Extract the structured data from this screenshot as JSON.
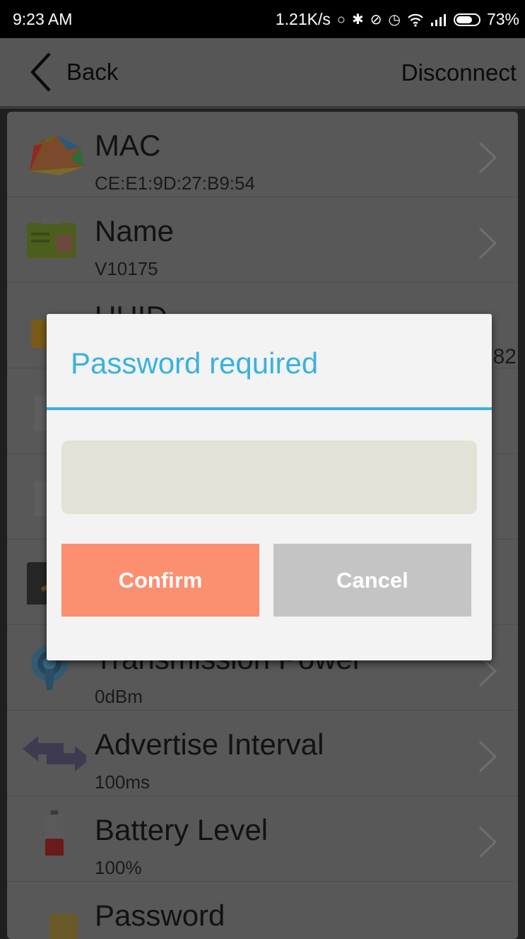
{
  "status_bar": {
    "time": "9:23 AM",
    "net_speed": "1.21K/s",
    "battery_text": "73%",
    "battery_level": 0.73,
    "icons": [
      "sync-icon",
      "bluetooth-icon",
      "mute-icon",
      "alarm-icon",
      "wifi-icon",
      "signal-icon",
      "battery-icon"
    ]
  },
  "app_bar": {
    "back_label": "Back",
    "disconnect_label": "Disconnect"
  },
  "list": {
    "items": [
      {
        "title": "MAC",
        "value": "CE:E1:9D:27:B9:54",
        "icon": "color-fan-icon"
      },
      {
        "title": "Name",
        "value": "V10175",
        "icon": "id-card-icon"
      },
      {
        "title": "UUID",
        "value": "",
        "icon": "document-icon"
      },
      {
        "title": "",
        "value": "",
        "icon": "calendar-icon"
      },
      {
        "title": "",
        "value": "",
        "icon": "calendar-icon"
      },
      {
        "title": "",
        "value": "",
        "icon": "device-icon"
      },
      {
        "title": "Transmission Power",
        "value": "0dBm",
        "icon": "antenna-icon"
      },
      {
        "title": "Advertise Interval",
        "value": "100ms",
        "icon": "arrows-icon"
      },
      {
        "title": "Battery Level",
        "value": "100%",
        "icon": "battery-level-icon"
      },
      {
        "title": "Password",
        "value": "",
        "icon": "lock-icon"
      }
    ],
    "uuid_tail": "82"
  },
  "dialog": {
    "title": "Password required",
    "input_value": "",
    "input_placeholder": "",
    "confirm_label": "Confirm",
    "cancel_label": "Cancel"
  },
  "colors": {
    "accent": "#37b2e0",
    "confirm": "#fc8f70",
    "cancel": "#c4c4c4"
  }
}
